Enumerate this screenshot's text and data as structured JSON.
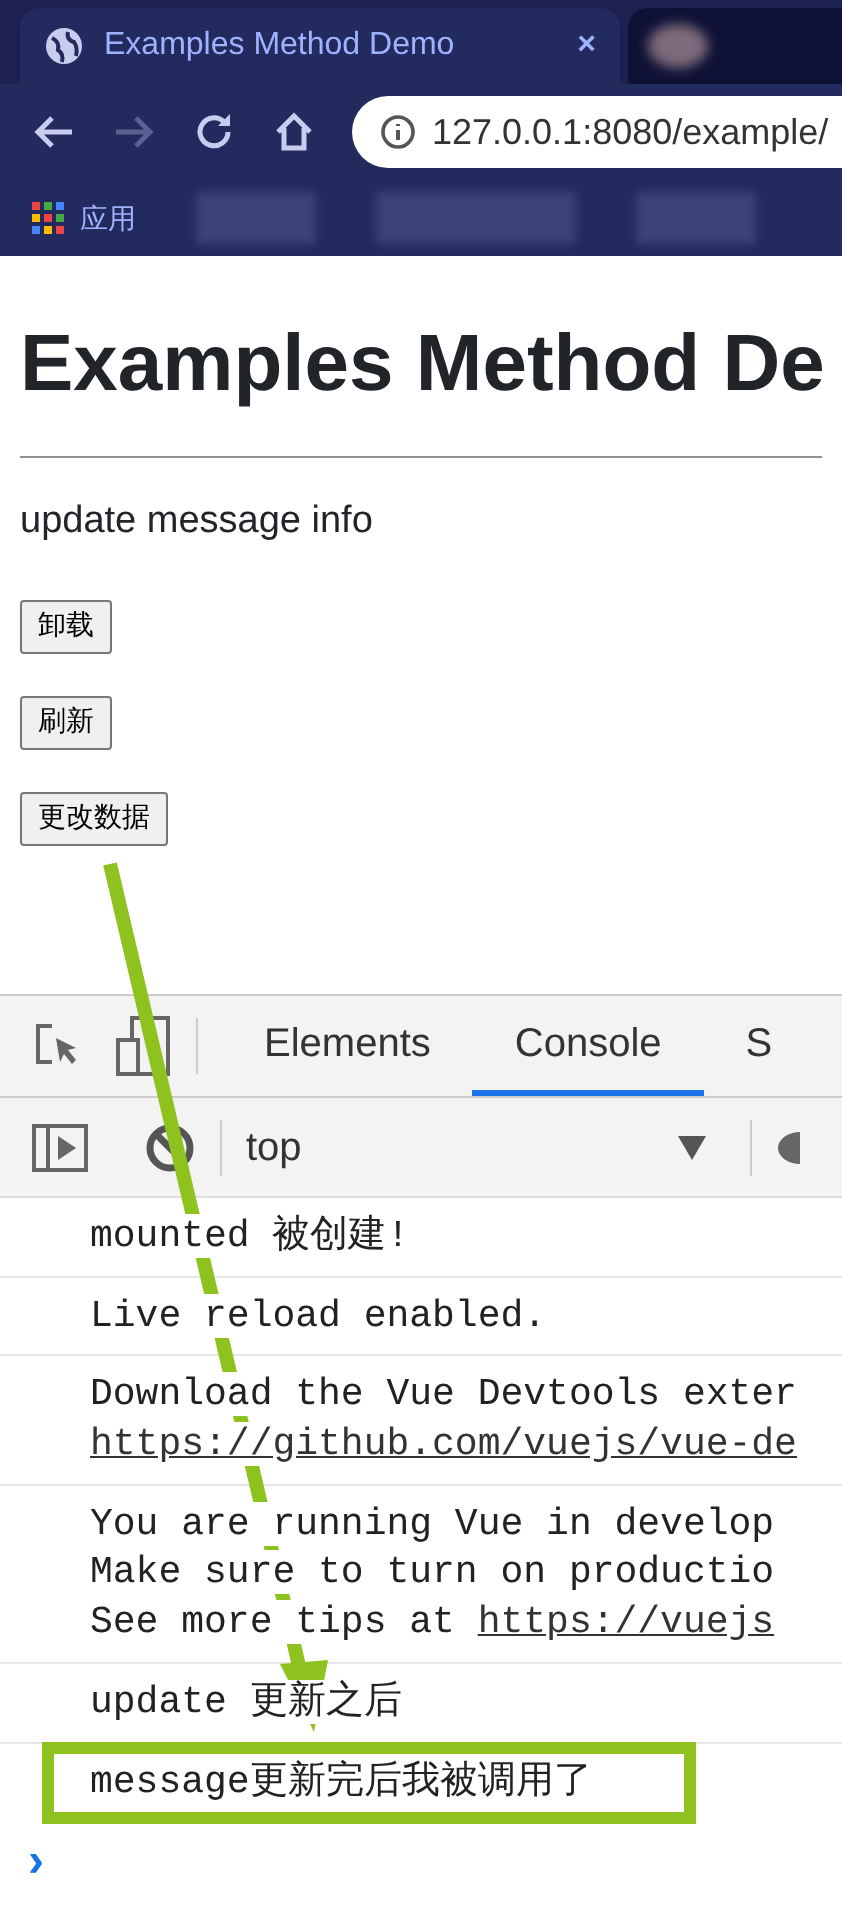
{
  "browser": {
    "tab_title": "Examples Method Demo",
    "close": "×",
    "url": "127.0.0.1:8080/example/",
    "bookmarks_label": "应用"
  },
  "page": {
    "heading": "Examples Method De",
    "message": "update message info",
    "buttons": [
      "卸载",
      "刷新",
      "更改数据"
    ]
  },
  "devtools": {
    "tabs": [
      {
        "label": "Elements",
        "selected": false
      },
      {
        "label": "Console",
        "selected": true
      },
      {
        "label": "S",
        "selected": false
      }
    ],
    "context": "top",
    "messages": [
      {
        "highlighted": false,
        "lines": [
          {
            "text": "mounted 被创建!"
          }
        ]
      },
      {
        "highlighted": false,
        "lines": [
          {
            "text": "Live reload enabled."
          }
        ]
      },
      {
        "highlighted": false,
        "lines": [
          {
            "text": "Download the Vue Devtools exter"
          },
          {
            "link": "https://github.com/vuejs/vue-de"
          }
        ]
      },
      {
        "highlighted": false,
        "lines": [
          {
            "text": "You are running Vue in develop"
          },
          {
            "text": "Make sure to turn on productio"
          },
          {
            "text": "See more tips at ",
            "link": "https://vuejs"
          }
        ]
      },
      {
        "highlighted": false,
        "lines": [
          {
            "text": "update 更新之后"
          }
        ]
      },
      {
        "highlighted": true,
        "lines": [
          {
            "text": "message更新完后我被调用了"
          }
        ]
      }
    ],
    "prompt": "›"
  }
}
